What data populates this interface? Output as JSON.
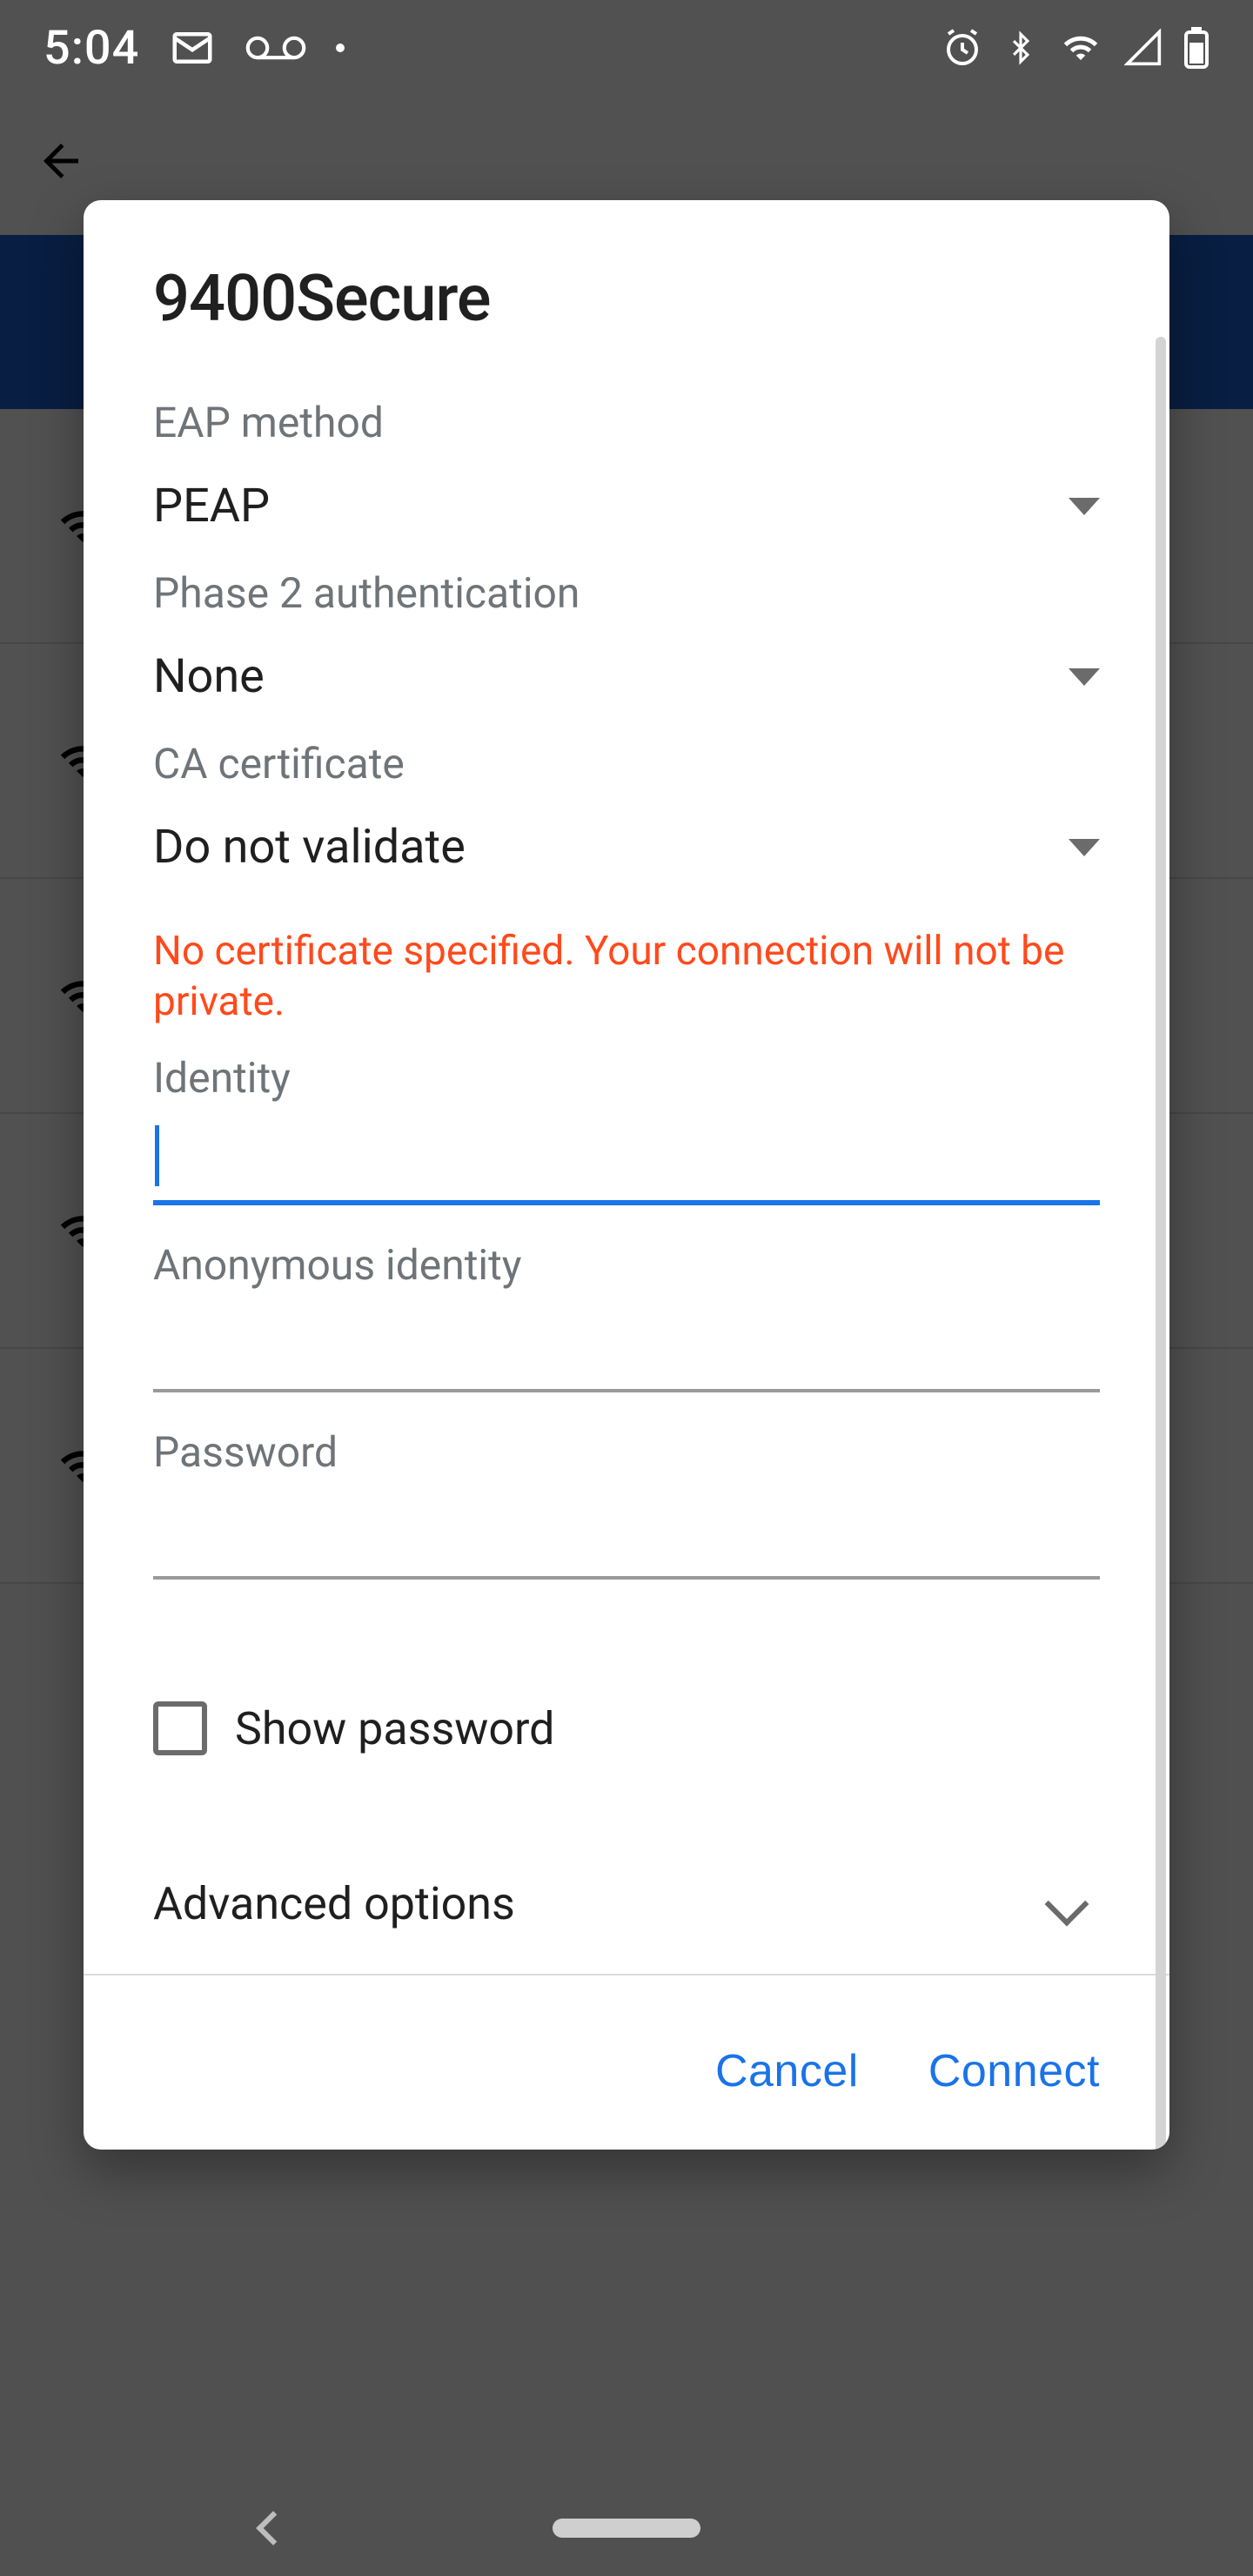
{
  "statusbar": {
    "time": "5:04"
  },
  "dialog": {
    "title": "9400Secure",
    "eap_method_label": "EAP method",
    "eap_method_value": "PEAP",
    "phase2_label": "Phase 2 authentication",
    "phase2_value": "None",
    "ca_cert_label": "CA certificate",
    "ca_cert_value": "Do not validate",
    "warning": "No certificate specified. Your connection will not be private.",
    "identity_label": "Identity",
    "identity_value": "",
    "anonymous_identity_label": "Anonymous identity",
    "anonymous_identity_value": "",
    "password_label": "Password",
    "password_value": "",
    "show_password_label": "Show password",
    "show_password_checked": false,
    "advanced_label": "Advanced options",
    "cancel_label": "Cancel",
    "connect_label": "Connect"
  }
}
